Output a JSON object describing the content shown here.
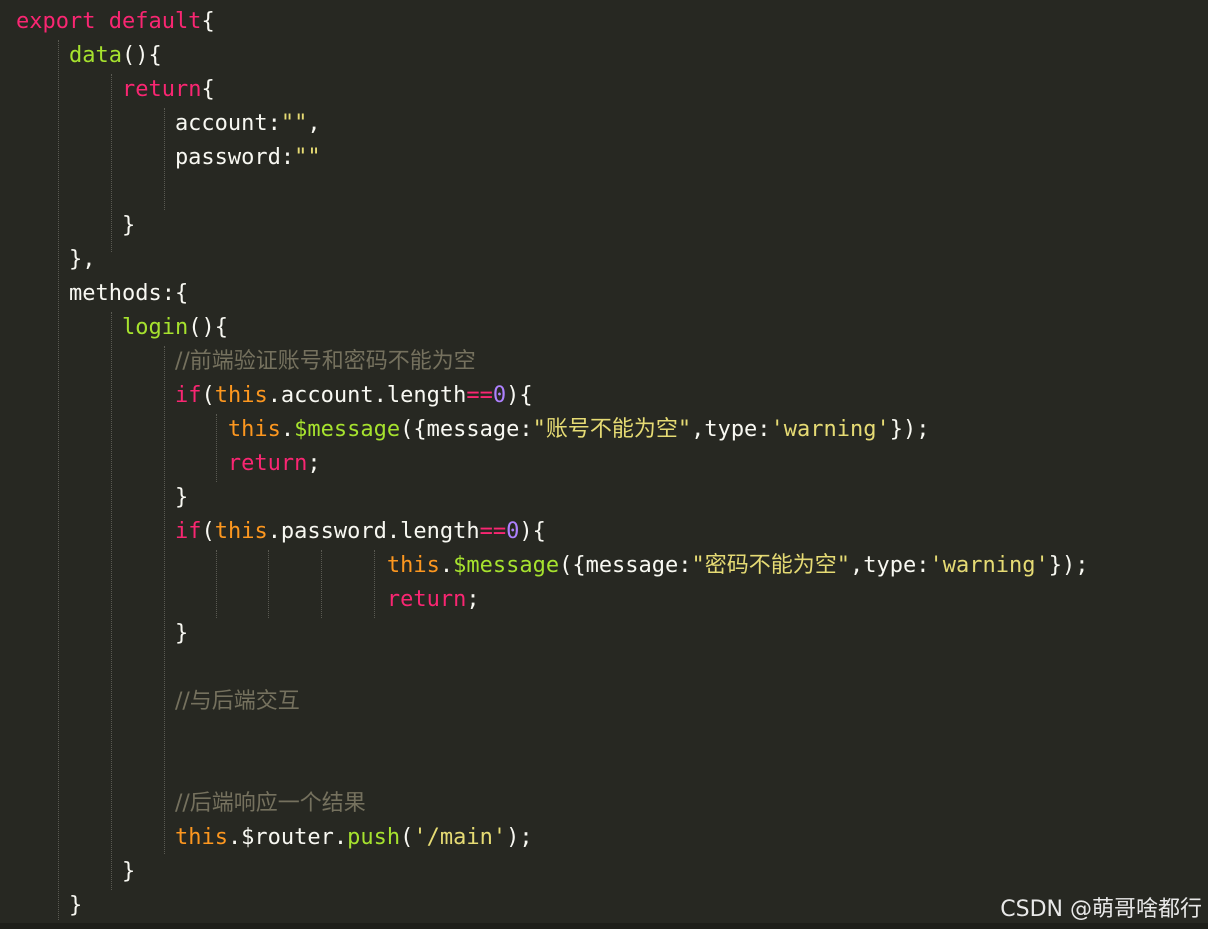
{
  "editor": {
    "watermark": "CSDN @萌哥啥都行",
    "lines": [
      [
        {
          "t": "export default",
          "c": "kw"
        },
        {
          "t": "{",
          "c": "pl"
        }
      ],
      [
        {
          "t": "    ",
          "c": "pl"
        },
        {
          "t": "data",
          "c": "fn"
        },
        {
          "t": "(){",
          "c": "pl"
        }
      ],
      [
        {
          "t": "        ",
          "c": "pl"
        },
        {
          "t": "return",
          "c": "kw"
        },
        {
          "t": "{",
          "c": "pl"
        }
      ],
      [
        {
          "t": "            account:",
          "c": "pl"
        },
        {
          "t": "\"\"",
          "c": "str"
        },
        {
          "t": ",",
          "c": "pl"
        }
      ],
      [
        {
          "t": "            password:",
          "c": "pl"
        },
        {
          "t": "\"\"",
          "c": "str"
        }
      ],
      [],
      [
        {
          "t": "        }",
          "c": "pl"
        }
      ],
      [
        {
          "t": "    },",
          "c": "pl"
        }
      ],
      [
        {
          "t": "    methods:{",
          "c": "pl"
        }
      ],
      [
        {
          "t": "        ",
          "c": "pl"
        },
        {
          "t": "login",
          "c": "fn"
        },
        {
          "t": "(){",
          "c": "pl"
        }
      ],
      [
        {
          "t": "            ",
          "c": "pl"
        },
        {
          "t": "//前端验证账号和密码不能为空",
          "c": "cm"
        }
      ],
      [
        {
          "t": "            ",
          "c": "pl"
        },
        {
          "t": "if",
          "c": "kw"
        },
        {
          "t": "(",
          "c": "pl"
        },
        {
          "t": "this",
          "c": "th"
        },
        {
          "t": ".account.length",
          "c": "pl"
        },
        {
          "t": "==",
          "c": "kw"
        },
        {
          "t": "0",
          "c": "num"
        },
        {
          "t": "){",
          "c": "pl"
        }
      ],
      [
        {
          "t": "                ",
          "c": "pl"
        },
        {
          "t": "this",
          "c": "th"
        },
        {
          "t": ".",
          "c": "pl"
        },
        {
          "t": "$message",
          "c": "fn"
        },
        {
          "t": "({message:",
          "c": "pl"
        },
        {
          "t": "\"账号不能为空\"",
          "c": "str"
        },
        {
          "t": ",type:",
          "c": "pl"
        },
        {
          "t": "'warning'",
          "c": "str"
        },
        {
          "t": "});",
          "c": "pl"
        }
      ],
      [
        {
          "t": "                ",
          "c": "pl"
        },
        {
          "t": "return",
          "c": "kw"
        },
        {
          "t": ";",
          "c": "pl"
        }
      ],
      [
        {
          "t": "            }",
          "c": "pl"
        }
      ],
      [
        {
          "t": "            ",
          "c": "pl"
        },
        {
          "t": "if",
          "c": "kw"
        },
        {
          "t": "(",
          "c": "pl"
        },
        {
          "t": "this",
          "c": "th"
        },
        {
          "t": ".password.length",
          "c": "pl"
        },
        {
          "t": "==",
          "c": "kw"
        },
        {
          "t": "0",
          "c": "num"
        },
        {
          "t": "){",
          "c": "pl"
        }
      ],
      [
        {
          "t": "                            ",
          "c": "pl"
        },
        {
          "t": "this",
          "c": "th"
        },
        {
          "t": ".",
          "c": "pl"
        },
        {
          "t": "$message",
          "c": "fn"
        },
        {
          "t": "({message:",
          "c": "pl"
        },
        {
          "t": "\"密码不能为空\"",
          "c": "str"
        },
        {
          "t": ",type:",
          "c": "pl"
        },
        {
          "t": "'warning'",
          "c": "str"
        },
        {
          "t": "});",
          "c": "pl"
        }
      ],
      [
        {
          "t": "                            ",
          "c": "pl"
        },
        {
          "t": "return",
          "c": "kw"
        },
        {
          "t": ";",
          "c": "pl"
        }
      ],
      [
        {
          "t": "            }",
          "c": "pl"
        }
      ],
      [],
      [
        {
          "t": "            ",
          "c": "pl"
        },
        {
          "t": "//与后端交互",
          "c": "cm"
        }
      ],
      [],
      [],
      [
        {
          "t": "            ",
          "c": "pl"
        },
        {
          "t": "//后端响应一个结果",
          "c": "cm"
        }
      ],
      [
        {
          "t": "            ",
          "c": "pl"
        },
        {
          "t": "this",
          "c": "th"
        },
        {
          "t": ".$router.",
          "c": "pl"
        },
        {
          "t": "push",
          "c": "fn"
        },
        {
          "t": "(",
          "c": "pl"
        },
        {
          "t": "'/main'",
          "c": "str"
        },
        {
          "t": ");",
          "c": "pl"
        }
      ],
      [
        {
          "t": "        }",
          "c": "pl"
        }
      ],
      [
        {
          "t": "    }",
          "c": "pl"
        }
      ]
    ]
  }
}
